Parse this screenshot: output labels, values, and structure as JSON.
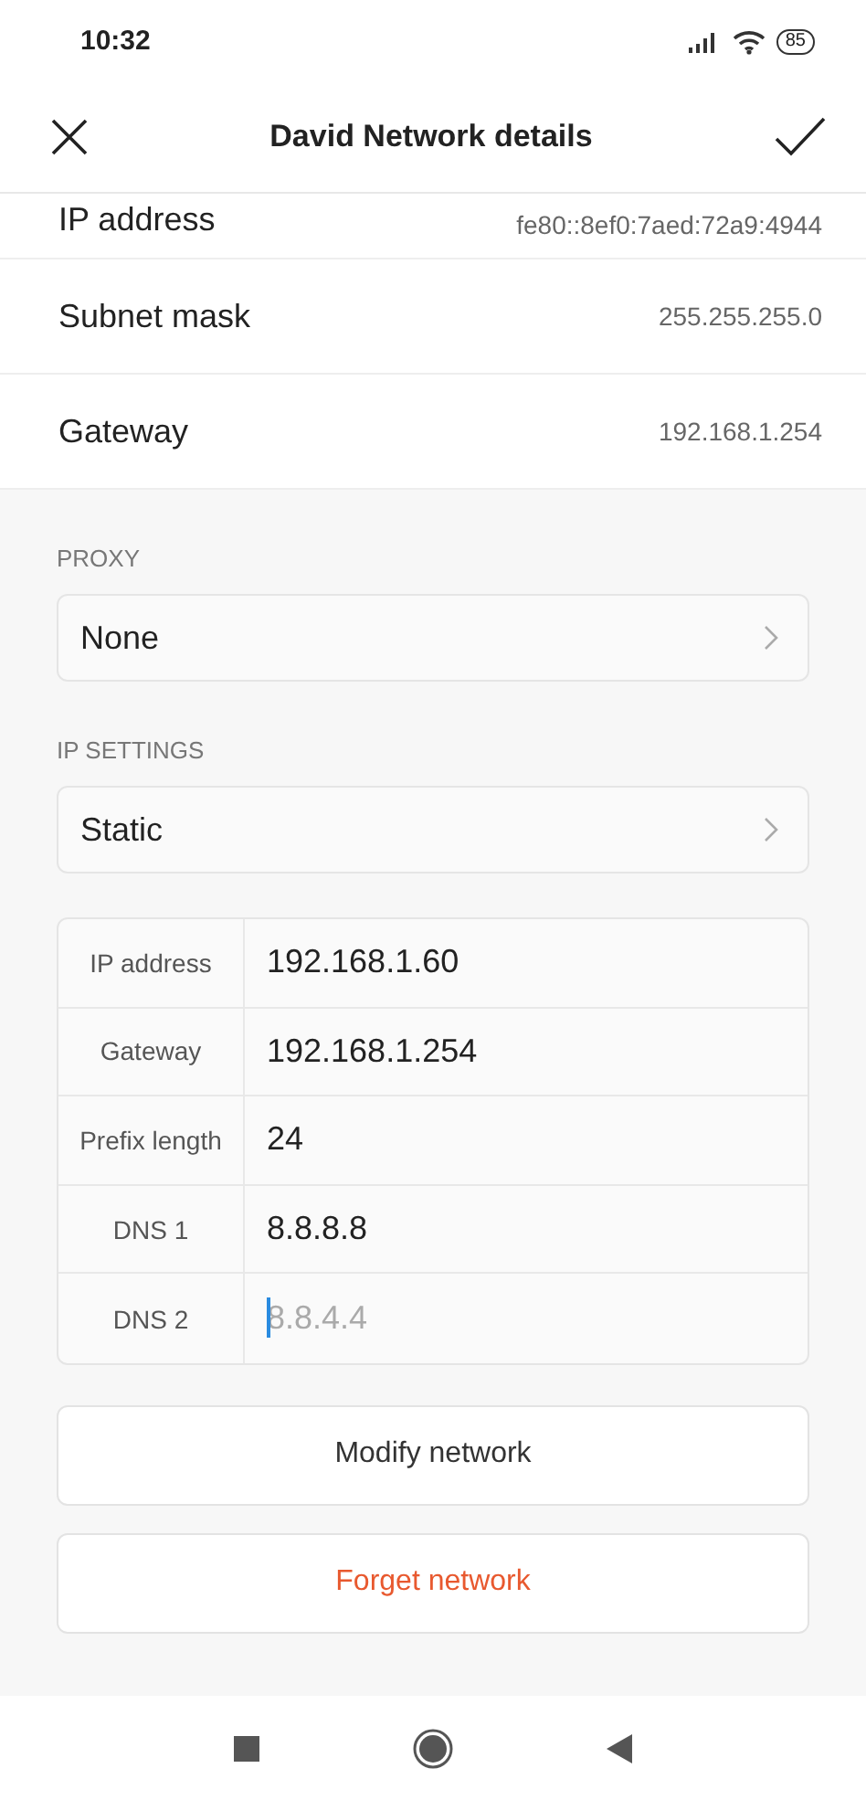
{
  "status_bar": {
    "time": "10:32",
    "battery": "85"
  },
  "header": {
    "title": "David Network details"
  },
  "info_rows": [
    {
      "label": "IP address",
      "value": "fe80::8ef0:7aed:72a9:4944",
      "cut": true
    },
    {
      "label": "Subnet mask",
      "value": "255.255.255.0",
      "cut": false
    },
    {
      "label": "Gateway",
      "value": "192.168.1.254",
      "cut": false
    }
  ],
  "proxy": {
    "label": "PROXY",
    "value": "None"
  },
  "ip_settings": {
    "label": "IP SETTINGS",
    "value": "Static"
  },
  "fields": [
    {
      "label": "IP address",
      "value": "192.168.1.60",
      "focused": false
    },
    {
      "label": "Gateway",
      "value": "192.168.1.254",
      "focused": false
    },
    {
      "label": "Prefix length",
      "value": "24",
      "focused": false
    },
    {
      "label": "DNS 1",
      "value": "8.8.8.8",
      "focused": false
    },
    {
      "label": "DNS 2",
      "placeholder": "8.8.4.4",
      "focused": true
    }
  ],
  "buttons": [
    {
      "label": "Modify network",
      "kind": "normal"
    },
    {
      "label": "Forget network",
      "kind": "danger"
    }
  ]
}
